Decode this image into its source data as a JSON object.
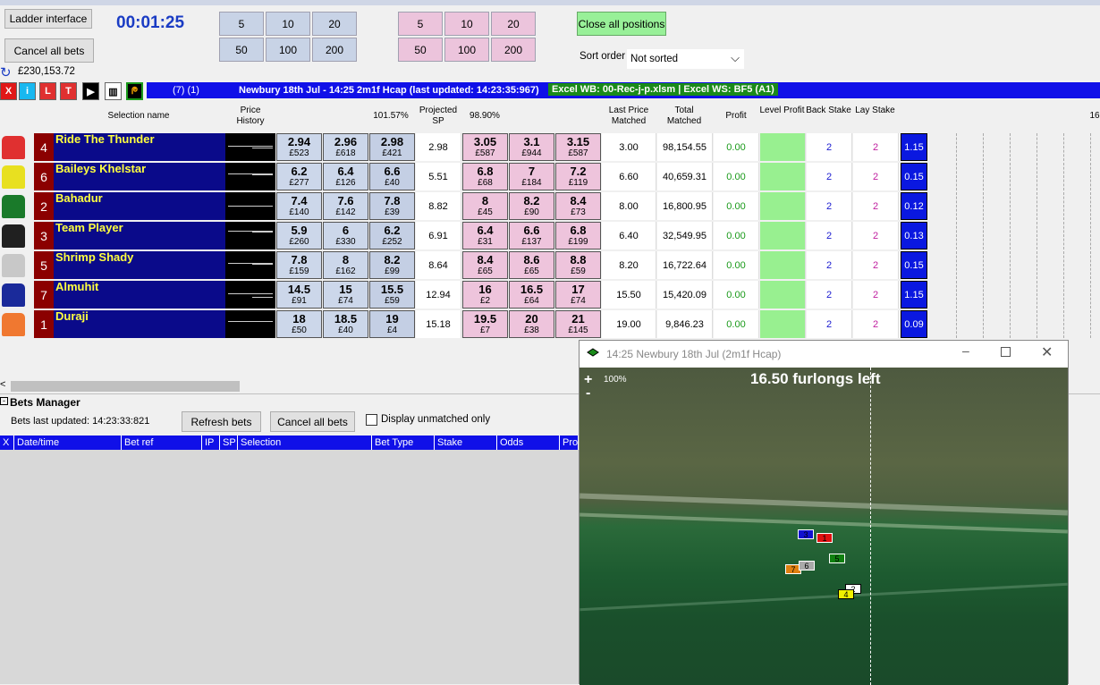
{
  "toolbar": {
    "ladder_label": "Ladder interface",
    "cancel_label": "Cancel all bets",
    "clock": "00:01:25",
    "balance": "£230,153.72",
    "back_stakes": [
      "5",
      "10",
      "20",
      "50",
      "100",
      "200"
    ],
    "lay_stakes": [
      "5",
      "10",
      "20",
      "50",
      "100",
      "200"
    ],
    "close_label": "Close all positions",
    "sort_label": "Sort order",
    "sort_value": "Not sorted"
  },
  "icons": [
    "X",
    "i",
    "L",
    "T"
  ],
  "infobar": {
    "counts": "(7) (1)",
    "title": "Newbury 18th Jul - 14:25 2m1f Hcap (last updated: 14:23:35:967)",
    "excel": "Excel WB: 00-Rec-j-p.xlsm | Excel WS: BF5 (A1)"
  },
  "headers": {
    "selection": "Selection name",
    "price_history": "Price History",
    "back_pct": "101.57%",
    "projected_sp": "Projected SP",
    "lay_pct": "98.90%",
    "last_price": "Last Price Matched",
    "total_matched": "Total Matched",
    "profit": "Profit",
    "level_profit": "Level Profit",
    "back_stake": "Back Stake",
    "lay_stake": "Lay Stake",
    "extra": "16"
  },
  "runners": [
    {
      "num": "4",
      "name": "Ride The Thunder",
      "silk": "#e03030",
      "back": [
        [
          "2.94",
          "£523"
        ],
        [
          "2.96",
          "£618"
        ],
        [
          "2.98",
          "£421"
        ]
      ],
      "lay": [
        [
          "3.05",
          "£587"
        ],
        [
          "3.1",
          "£944"
        ],
        [
          "3.15",
          "£587"
        ]
      ],
      "sp": "2.98",
      "lpm": "3.00",
      "tm": "98,154.55",
      "profit": "0.00",
      "bs": "2",
      "ls": "2",
      "blue": "1.15"
    },
    {
      "num": "6",
      "name": "Baileys Khelstar",
      "silk": "#e8e020",
      "back": [
        [
          "6.2",
          "£277"
        ],
        [
          "6.4",
          "£126"
        ],
        [
          "6.6",
          "£40"
        ]
      ],
      "lay": [
        [
          "6.8",
          "£68"
        ],
        [
          "7",
          "£184"
        ],
        [
          "7.2",
          "£119"
        ]
      ],
      "sp": "5.51",
      "lpm": "6.60",
      "tm": "40,659.31",
      "profit": "0.00",
      "bs": "2",
      "ls": "2",
      "blue": "0.15"
    },
    {
      "num": "2",
      "name": "Bahadur",
      "silk": "#1a7a2a",
      "back": [
        [
          "7.4",
          "£140"
        ],
        [
          "7.6",
          "£142"
        ],
        [
          "7.8",
          "£39"
        ]
      ],
      "lay": [
        [
          "8",
          "£45"
        ],
        [
          "8.2",
          "£90"
        ],
        [
          "8.4",
          "£73"
        ]
      ],
      "sp": "8.82",
      "lpm": "8.00",
      "tm": "16,800.95",
      "profit": "0.00",
      "bs": "2",
      "ls": "2",
      "blue": "0.12"
    },
    {
      "num": "3",
      "name": "Team Player",
      "silk": "#202020",
      "back": [
        [
          "5.9",
          "£260"
        ],
        [
          "6",
          "£330"
        ],
        [
          "6.2",
          "£252"
        ]
      ],
      "lay": [
        [
          "6.4",
          "£31"
        ],
        [
          "6.6",
          "£137"
        ],
        [
          "6.8",
          "£199"
        ]
      ],
      "sp": "6.91",
      "lpm": "6.40",
      "tm": "32,549.95",
      "profit": "0.00",
      "bs": "2",
      "ls": "2",
      "blue": "0.13"
    },
    {
      "num": "5",
      "name": "Shrimp Shady",
      "silk": "#c8c8c8",
      "back": [
        [
          "7.8",
          "£159"
        ],
        [
          "8",
          "£162"
        ],
        [
          "8.2",
          "£99"
        ]
      ],
      "lay": [
        [
          "8.4",
          "£65"
        ],
        [
          "8.6",
          "£65"
        ],
        [
          "8.8",
          "£59"
        ]
      ],
      "sp": "8.64",
      "lpm": "8.20",
      "tm": "16,722.64",
      "profit": "0.00",
      "bs": "2",
      "ls": "2",
      "blue": "0.15"
    },
    {
      "num": "7",
      "name": "Almuhit",
      "silk": "#1a2a9a",
      "back": [
        [
          "14.5",
          "£91"
        ],
        [
          "15",
          "£74"
        ],
        [
          "15.5",
          "£59"
        ]
      ],
      "lay": [
        [
          "16",
          "£2"
        ],
        [
          "16.5",
          "£64"
        ],
        [
          "17",
          "£74"
        ]
      ],
      "sp": "12.94",
      "lpm": "15.50",
      "tm": "15,420.09",
      "profit": "0.00",
      "bs": "2",
      "ls": "2",
      "blue": "1.15"
    },
    {
      "num": "1",
      "name": "Duraji",
      "silk": "#f07830",
      "back": [
        [
          "18",
          "£50"
        ],
        [
          "18.5",
          "£40"
        ],
        [
          "19",
          "£4"
        ]
      ],
      "lay": [
        [
          "19.5",
          "£7"
        ],
        [
          "20",
          "£38"
        ],
        [
          "21",
          "£145"
        ]
      ],
      "sp": "15.18",
      "lpm": "19.00",
      "tm": "9,846.23",
      "profit": "0.00",
      "bs": "2",
      "ls": "2",
      "blue": "0.09"
    }
  ],
  "bets": {
    "title": "Bets Manager",
    "updated": "Bets last updated: 14:23:33:821",
    "refresh": "Refresh bets",
    "cancel": "Cancel all bets",
    "unmatched": "Display unmatched only",
    "columns": [
      "X",
      "Date/time",
      "Bet ref",
      "IP",
      "SP",
      "Selection",
      "Bet Type",
      "Stake",
      "Odds",
      "Pro"
    ]
  },
  "video": {
    "title": "14:25 Newbury 18th Jul (2m1f Hcap)",
    "zoom": "100%",
    "furlongs": "16.50 furlongs left",
    "plus": "+",
    "minus": "-",
    "tags": [
      {
        "n": "3",
        "c": "#1010d0"
      },
      {
        "n": "1",
        "c": "#e01010"
      },
      {
        "n": "5",
        "c": "#108010"
      },
      {
        "n": "7",
        "c": "#e08010"
      },
      {
        "n": "6",
        "c": "#aaaaaa"
      },
      {
        "n": "2",
        "c": "#ffffff"
      },
      {
        "n": "4",
        "c": "#f0f000"
      }
    ]
  }
}
